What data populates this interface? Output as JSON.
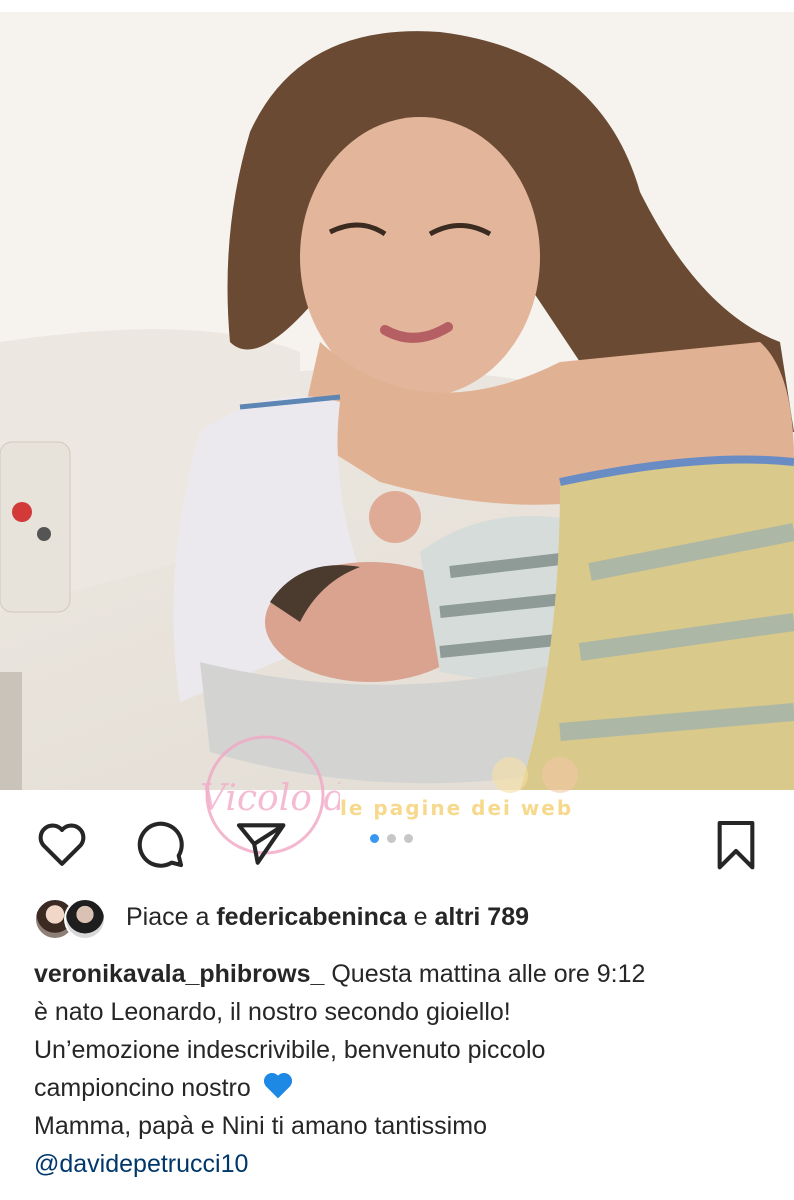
{
  "post": {
    "likes": {
      "prefix": "Piace a",
      "user": "federicabeninca",
      "conj": "e",
      "others": "altri 789"
    },
    "caption": {
      "username": "veronikavala_phibrows_",
      "line1": "Questa mattina alle ore 9:12",
      "line2": "è nato Leonardo, il nostro secondo gioiello!",
      "line3": "Un’emozione indescrivibile, benvenuto piccolo",
      "line4": "campioncino nostro",
      "line4_emoji": "blue-heart-icon",
      "line5": "Mamma, papà e Nini ti amano tantissimo",
      "mention": "@davidepetrucci10"
    },
    "carousel": {
      "count": 3,
      "active": 1
    }
  },
  "watermarks": {
    "left": "Vicolo delle News",
    "right": "le pagine dei web"
  },
  "icons": {
    "like": "heart-outline-icon",
    "comment": "comment-bubble-icon",
    "share": "paper-plane-icon",
    "save": "bookmark-icon"
  },
  "colors": {
    "text": "#262626",
    "mention": "#00376b",
    "active_dot": "#3897f0",
    "inactive_dot": "#c7c7c7",
    "blue_heart": "#1e88e5"
  }
}
